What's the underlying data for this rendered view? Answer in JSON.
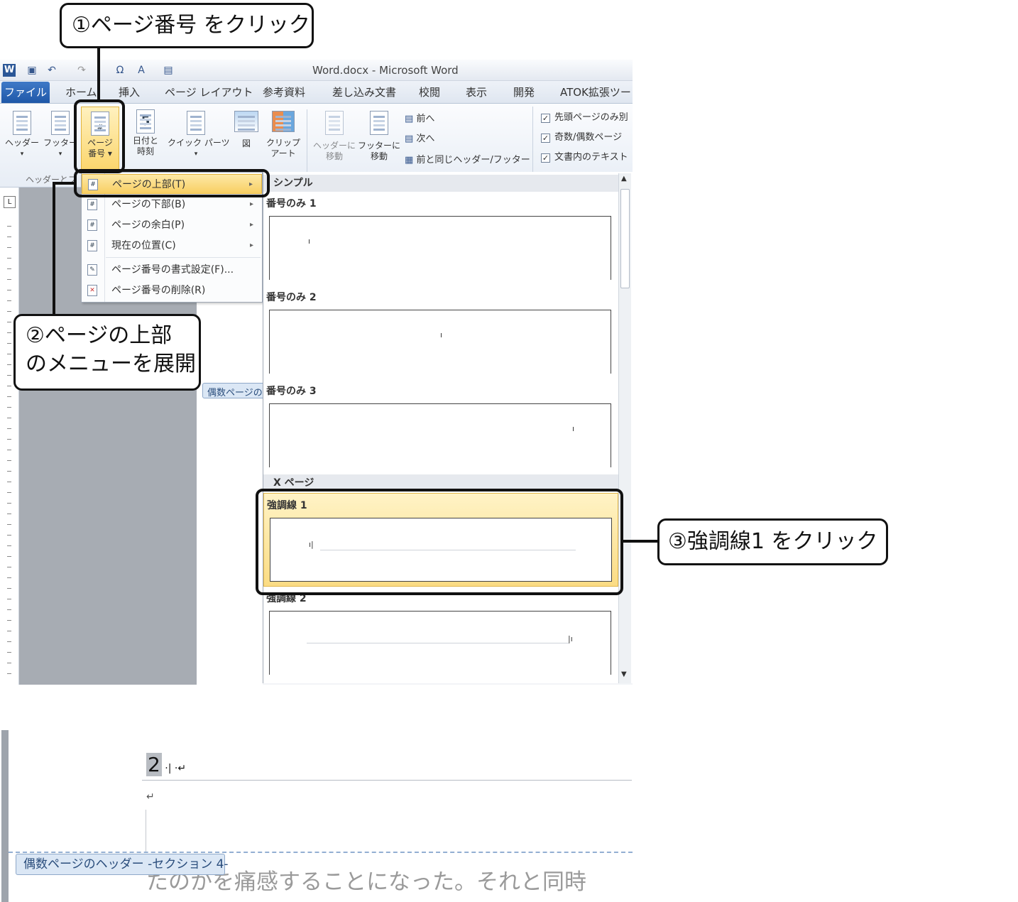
{
  "callouts": {
    "step1": "①ページ番号 をクリック",
    "step2_line1": "②ページの上部",
    "step2_line2": "のメニューを展開",
    "step3": "③強調線1 をクリック"
  },
  "window": {
    "title": "Word.docx - Microsoft Word",
    "qat_icons": [
      "word-icon",
      "save-icon",
      "undo-icon",
      "redo-icon",
      "omega-icon",
      "font-color-icon",
      "paste-icon"
    ]
  },
  "tabs": [
    "ファイル",
    "ホーム",
    "挿入",
    "ページ レイアウト",
    "参考資料",
    "差し込み文書",
    "校閲",
    "表示",
    "開発",
    "ATOK拡張ツー"
  ],
  "ribbon": {
    "header": "ヘッダー",
    "footer": "フッター",
    "page_number_l1": "ページ",
    "page_number_l2": "番号",
    "date_l1": "日付と",
    "date_l2": "時刻",
    "quick_parts": "クイック パーツ",
    "picture": "図",
    "clipart_l1": "クリップ",
    "clipart_l2": "アート",
    "goto_header_l1": "ヘッダーに",
    "goto_header_l2": "移動",
    "goto_footer_l1": "フッターに",
    "goto_footer_l2": "移動",
    "prev": "前へ",
    "next": "次へ",
    "link_prev": "前と同じヘッダー/フッター",
    "opt1": "先頭ページのみ別",
    "opt2": "奇数/偶数ページ",
    "opt3": "文書内のテキスト",
    "group_label": "ヘッダーとフ"
  },
  "menu": [
    {
      "label": "ページの上部(T)",
      "arrow": "▸"
    },
    {
      "label": "ページの下部(B)",
      "arrow": "▸"
    },
    {
      "label": "ページの余白(P)",
      "arrow": "▸"
    },
    {
      "label": "現在の位置(C)",
      "arrow": "▸"
    },
    {
      "label": "ページ番号の書式設定(F)..."
    },
    {
      "label": "ページ番号の削除(R)"
    }
  ],
  "gallery": {
    "section1": "シンプル",
    "item1": "番号のみ 1",
    "item2": "番号のみ 2",
    "item3": "番号のみ 3",
    "section2": "X ページ",
    "item4": "強調線 1",
    "item5": "強調線 2"
  },
  "doc": {
    "even_header_short": "偶数ページの",
    "page_number_char": "2",
    "para_mark": "↵",
    "even_header_tag": "偶数ページのヘッダー -セクション 4-",
    "body_text": "たのかを痛感することになった。それと同時"
  }
}
